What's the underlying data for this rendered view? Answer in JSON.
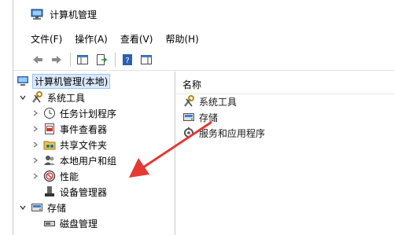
{
  "window": {
    "title": "计算机管理",
    "app_icon": "computer-management-icon"
  },
  "menu": [
    {
      "label": "文件(F)"
    },
    {
      "label": "操作(A)"
    },
    {
      "label": "查看(V)"
    },
    {
      "label": "帮助(H)"
    }
  ],
  "toolbar": {
    "buttons": [
      "back-arrow-icon",
      "forward-arrow-icon",
      "show-tree-icon",
      "export-list-icon",
      "help-icon",
      "action-pane-icon"
    ]
  },
  "tree": {
    "root": "计算机管理(本地)",
    "system_tools": "系统工具",
    "task_scheduler": "任务计划程序",
    "event_viewer": "事件查看器",
    "shared_folders": "共享文件夹",
    "local_users": "本地用户和组",
    "performance": "性能",
    "device_manager": "设备管理器",
    "storage": "存储",
    "disk_management": "磁盘管理"
  },
  "list": {
    "column_name": "名称",
    "items": [
      "系统工具",
      "存储",
      "服务和应用程序"
    ]
  },
  "colors": {
    "annotation_arrow": "#e53935",
    "selection": "#d9e8fb"
  }
}
